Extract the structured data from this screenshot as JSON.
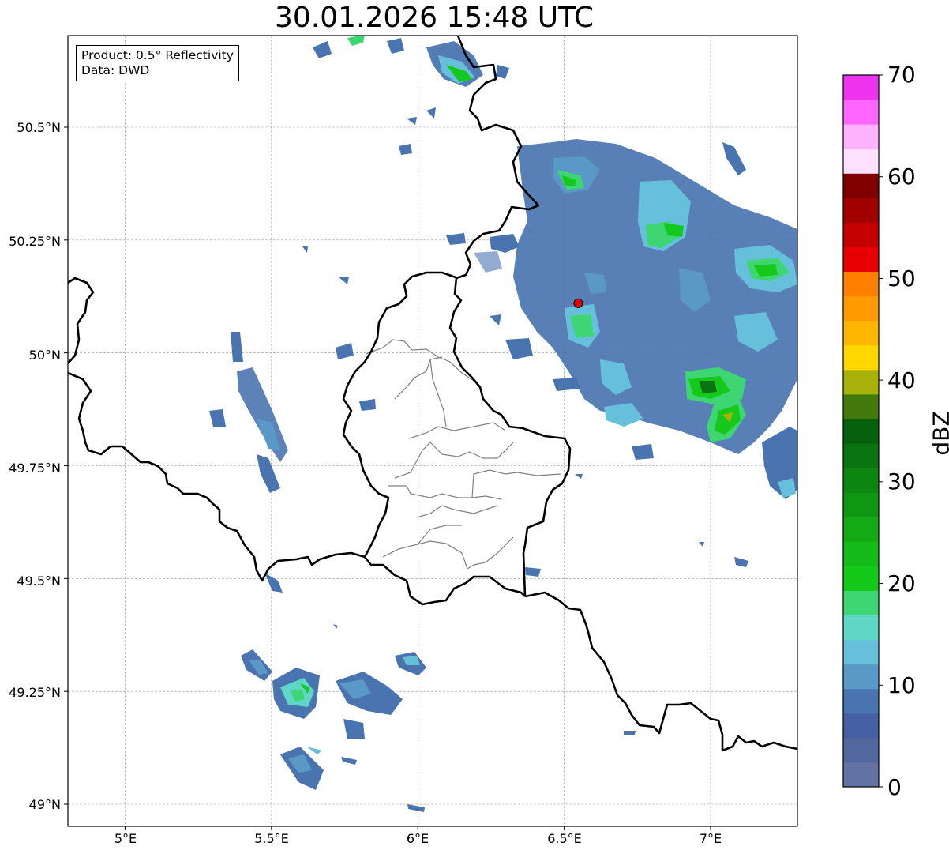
{
  "title": "30.01.2026 15:48 UTC",
  "info_box": {
    "product": "Product: 0.5° Reflectivity",
    "data_source": "Data: DWD"
  },
  "axes": {
    "lon_range": [
      4.8,
      7.3
    ],
    "lat_range": [
      48.95,
      50.7
    ],
    "x_ticks": [
      {
        "value": 5.0,
        "label": "5°E"
      },
      {
        "value": 5.5,
        "label": "5.5°E"
      },
      {
        "value": 6.0,
        "label": "6°E"
      },
      {
        "value": 6.5,
        "label": "6.5°E"
      },
      {
        "value": 7.0,
        "label": "7°E"
      }
    ],
    "y_ticks": [
      {
        "value": 50.5,
        "label": "50.5°N"
      },
      {
        "value": 50.25,
        "label": "50.25°N"
      },
      {
        "value": 50.0,
        "label": "50°N"
      },
      {
        "value": 49.75,
        "label": "49.75°N"
      },
      {
        "value": 49.5,
        "label": "49.5°N"
      },
      {
        "value": 49.25,
        "label": "49.25°N"
      },
      {
        "value": 49.0,
        "label": "49°N"
      }
    ],
    "grid": true
  },
  "radar_site": {
    "lon": 6.548,
    "lat": 50.11,
    "color": "#e00000"
  },
  "colorbar": {
    "label": "dBZ",
    "min": 0,
    "max": 70,
    "ticks": [
      "0",
      "10",
      "20",
      "30",
      "40",
      "50",
      "60",
      "70"
    ],
    "colors": [
      "#6272a4",
      "#52679e",
      "#4560a3",
      "#4a74b0",
      "#5a99c7",
      "#66c0dc",
      "#5fd6c6",
      "#3dd672",
      "#14c91a",
      "#15bb18",
      "#13aa16",
      "#0f9713",
      "#0c8611",
      "#0a7410",
      "#07600c",
      "#437a0b",
      "#a8b00a",
      "#ffd700",
      "#ffb600",
      "#ff9a00",
      "#ff7f00",
      "#e60000",
      "#c40000",
      "#a30000",
      "#800000",
      "#ffe0ff",
      "#ffb3ff",
      "#ff66ff",
      "#ee33ee"
    ]
  }
}
